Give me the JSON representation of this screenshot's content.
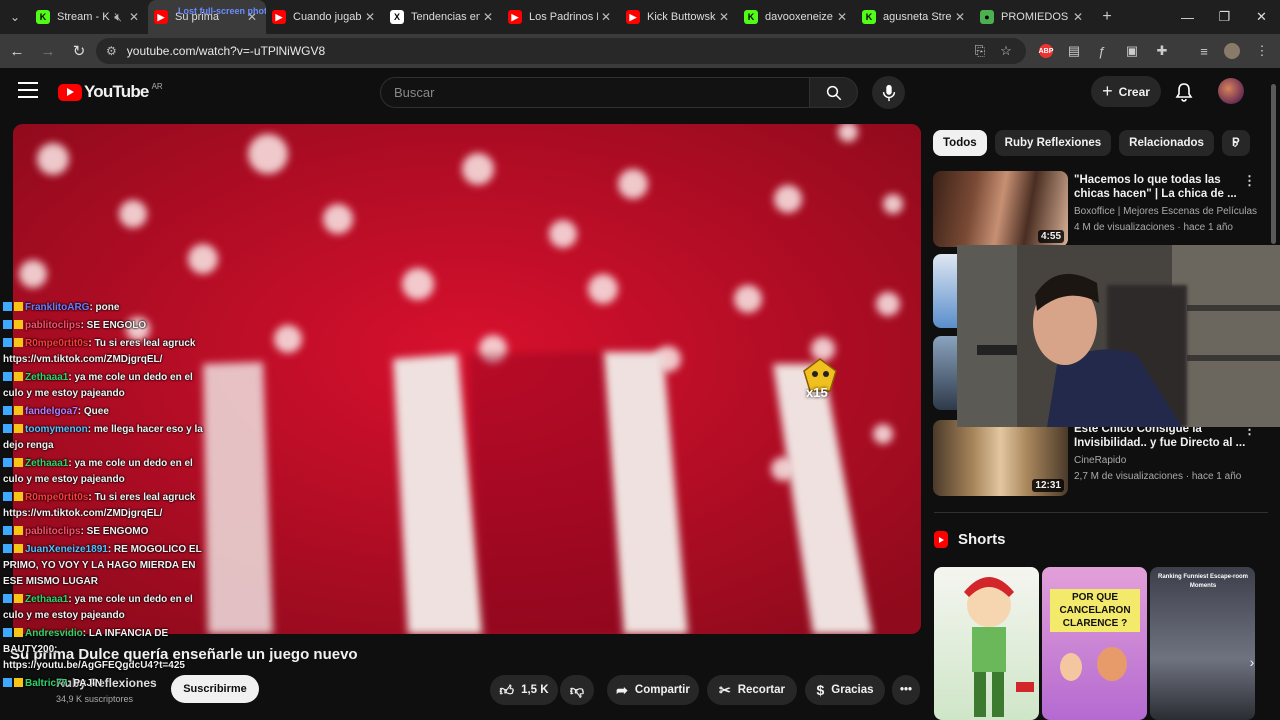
{
  "browser": {
    "tabs": [
      {
        "title": "Stream - K",
        "fav_color": "#53fc18",
        "fav_glyph": "K",
        "muted": true
      },
      {
        "title": "Su prima",
        "fav_color": "#ff0000",
        "fav_glyph": "▶",
        "active": true,
        "overlay": "Lost full-screen photos(s)"
      },
      {
        "title": "Cuando jugab",
        "fav_color": "#ff0000",
        "fav_glyph": "▶"
      },
      {
        "title": "Tendencias en",
        "fav_color": "#ffffff",
        "fav_glyph": "X"
      },
      {
        "title": "Los Padrinos M",
        "fav_color": "#ff0000",
        "fav_glyph": "▶"
      },
      {
        "title": "Kick Buttowski",
        "fav_color": "#ff0000",
        "fav_glyph": "▶"
      },
      {
        "title": "davooxeneize",
        "fav_color": "#53fc18",
        "fav_glyph": "K"
      },
      {
        "title": "agusneta Strea",
        "fav_color": "#53fc18",
        "fav_glyph": "K"
      },
      {
        "title": "PROMIEDOS -",
        "fav_color": "#4caf50",
        "fav_glyph": "●"
      }
    ],
    "url": "youtube.com/watch?v=-uTPlNiWGV8"
  },
  "youtube": {
    "logo_text": "YouTube",
    "country_code": "AR",
    "search_placeholder": "Buscar",
    "create_label": "Crear"
  },
  "chat": [
    {
      "user": "FranklitoARG",
      "text": ": pone",
      "user_color": "#6b7cff"
    },
    {
      "user": "pablitoclips",
      "text": ": SE ENGOLO",
      "user_color": "#ff4f6d"
    },
    {
      "user": "R0mpe0rtit0s",
      "text": ": Tu si eres leal agruck https://vm.tiktok.com/ZMDjgrqEL/",
      "user_color": "#ff3b3b"
    },
    {
      "user": "Zethaaa1",
      "text": ": ya me cole un dedo en el culo y me estoy pajeando",
      "user_color": "#2bd56b"
    },
    {
      "user": "fandelgoa7",
      "text": ": Quee",
      "user_color": "#b57cff"
    },
    {
      "user": "toomymenon",
      "text": ": me llega hacer eso y la dejo renga",
      "user_color": "#4fc3ff"
    },
    {
      "user": "Zethaaa1",
      "text": ": ya me cole un dedo en el culo y me estoy pajeando",
      "user_color": "#2bd56b"
    },
    {
      "user": "R0mpe0rtit0s",
      "text": ": Tu si eres leal agruck https://vm.tiktok.com/ZMDjgrqEL/",
      "user_color": "#ff3b3b"
    },
    {
      "user": "pablitoclips",
      "text": ": SE ENGOMO",
      "user_color": "#ff4f6d"
    },
    {
      "user": "JuanXeneize1891",
      "text": ": RE MOGOLICO EL PRIMO, YO VOY Y LA HAGO MIERDA EN ESE MISMO LUGAR",
      "user_color": "#4fc3ff"
    },
    {
      "user": "Zethaaa1",
      "text": ": ya me cole un dedo en el culo y me estoy pajeando",
      "user_color": "#2bd56b"
    },
    {
      "user": "Andresvidio",
      "text": ": LA INFANCIA DE BAUTY200: https://youtu.be/AgGFEQgdcU4?t=425",
      "user_color": "#2bd56b"
    },
    {
      "user": "Baltric77",
      "text": ": PAJIN",
      "user_color": "#2bd56b"
    }
  ],
  "video": {
    "title": "Su prima Dulce quería enseñarle un juego nuevo",
    "channel": "Ruby Reflexiones",
    "subscribers": "34,9 K suscriptores",
    "subscribe_label": "Suscribirme",
    "likes": "1,5 K",
    "share_label": "Compartir",
    "clip_label": "Recortar",
    "thanks_label": "Gracias",
    "cheer_badge": "x15"
  },
  "chips": [
    "Todos",
    "Ruby Reflexiones",
    "Relacionados",
    "P"
  ],
  "recommendations": [
    {
      "title": "\"Hacemos lo que todas las chicas hacen\" | La chica de ...",
      "channel": "Boxoffice | Mejores Escenas de Películas",
      "meta": "4 M de visualizaciones · hace 1 año",
      "duration": "4:55"
    },
    {
      "title": "Este Chico Consigue la Invisibilidad.. y fue Directo al ...",
      "channel": "CineRapido",
      "meta": "2,7 M de visualizaciones · hace 1 año",
      "duration": "12:31"
    }
  ],
  "shorts": {
    "heading": "Shorts",
    "items": [
      {
        "caption": ""
      },
      {
        "caption": "POR QUE CANCELARON CLARENCE ?"
      },
      {
        "caption": "Ranking Funniest Escape-room Moments"
      }
    ]
  },
  "colors": {
    "accent": "#ff0000",
    "bg": "#0f0f0f",
    "chip_bg": "#272727",
    "kick_green": "#53fc18"
  }
}
